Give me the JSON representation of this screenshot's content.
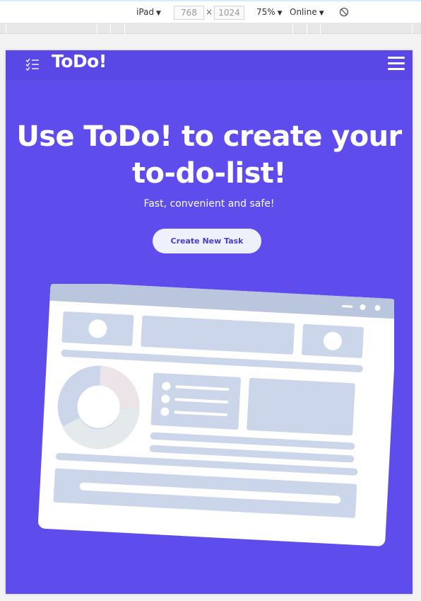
{
  "devtools": {
    "device": "iPad",
    "width": "768",
    "height": "1024",
    "times": "×",
    "zoom": "75%",
    "network": "Online",
    "dropdown_arrow": "▼",
    "rotate_icon": "rotate-icon"
  },
  "page": {
    "brand": "ToDo!",
    "brand_icon": "checklist-icon",
    "menu_icon": "hamburger-menu-icon",
    "hero_title": "Use ToDo! to create your to-do-list!",
    "hero_subtitle": "Fast, convenient and safe!",
    "cta_label": "Create New Task"
  },
  "colors": {
    "brand_purple": "#5e4cec",
    "button_bg": "#eef0fb",
    "button_text": "#4a3fc7"
  }
}
